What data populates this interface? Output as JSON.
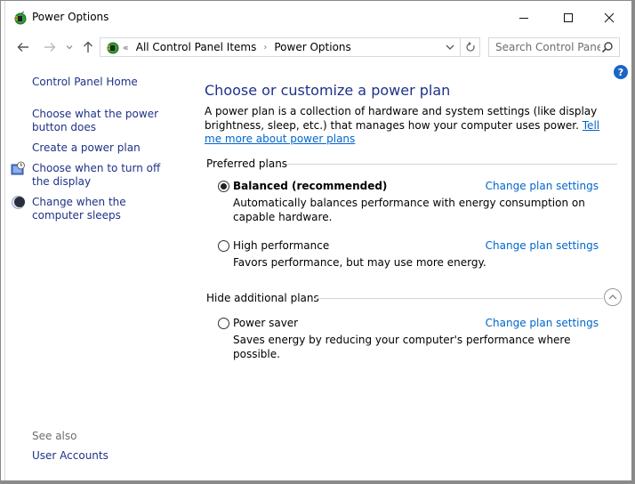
{
  "window": {
    "title": "Power Options",
    "icon": "power-options-icon",
    "controls": {
      "minimize": "minimize-icon",
      "maximize": "maximize-icon",
      "close": "close-icon"
    }
  },
  "navigation": {
    "back": "back-arrow-icon",
    "forward": "forward-arrow-icon",
    "recent": "chevron-down-icon",
    "up": "up-arrow-icon",
    "address": {
      "overflow": "«",
      "segments": [
        "All Control Panel Items",
        "Power Options"
      ],
      "separator": "›"
    },
    "refresh": "refresh-icon",
    "search": {
      "placeholder": "Search Control Panel",
      "value": ""
    }
  },
  "help": {
    "label": "?"
  },
  "sidebar": {
    "home": "Control Panel Home",
    "items": [
      {
        "label": "Choose what the power button does",
        "icon": null
      },
      {
        "label": "Create a power plan",
        "icon": null
      },
      {
        "label": "Choose when to turn off the display",
        "icon": "display-clock-icon"
      },
      {
        "label": "Change when the computer sleeps",
        "icon": "moon-icon"
      }
    ],
    "see_also": {
      "heading": "See also",
      "items": [
        {
          "label": "User Accounts"
        }
      ]
    }
  },
  "main": {
    "title": "Choose or customize a power plan",
    "intro": "A power plan is a collection of hardware and system settings (like display brightness, sleep, etc.) that manages how your computer uses power.",
    "intro_link": "Tell me more about power plans",
    "preferred": {
      "heading": "Preferred plans",
      "plans": [
        {
          "name": "Balanced (recommended)",
          "selected": true,
          "description": "Automatically balances performance with energy consumption on capable hardware.",
          "link": "Change plan settings"
        },
        {
          "name": "High performance",
          "selected": false,
          "description": "Favors performance, but may use more energy.",
          "link": "Change plan settings"
        }
      ]
    },
    "additional": {
      "heading": "Hide additional plans",
      "expanded": true,
      "plans": [
        {
          "name": "Power saver",
          "selected": false,
          "description": "Saves energy by reducing your computer's performance where possible.",
          "link": "Change plan settings"
        }
      ]
    }
  },
  "colors": {
    "nav_link": "#1e3287",
    "action_link": "#0066cc",
    "help_badge": "#1a66c4"
  }
}
